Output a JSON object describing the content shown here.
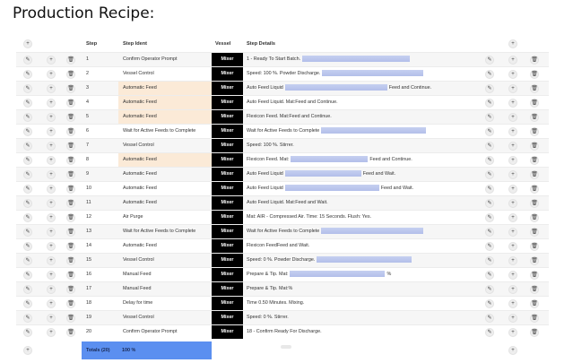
{
  "page_title": "Production Recipe:",
  "headers": {
    "step": "Step",
    "step_ident": "Step Ident",
    "vessel": "Vessel",
    "step_details": "Step Details"
  },
  "icons": {
    "edit": "pencil-icon",
    "add": "plus-circle-icon",
    "delete": "trash-icon"
  },
  "colors": {
    "vessel_bg": "#000000",
    "highlight": "#fbead7",
    "totals_bg": "#5b8ff0",
    "bar": "#c5cff0"
  },
  "rows": [
    {
      "step": "1",
      "ident": "Confirm Operator Prompt",
      "vessel": "Mixer",
      "details": "1 - Ready To Start Batch.",
      "suffix": "",
      "highlight": false
    },
    {
      "step": "2",
      "ident": "Vessel Control",
      "vessel": "Mixer",
      "details": "Speed: 100 %. Powder Discharge.",
      "suffix": "",
      "highlight": false
    },
    {
      "step": "3",
      "ident": "Automatic Feed",
      "vessel": "Mixer",
      "details": "Auto Feed Liquid",
      "suffix": "Feed and Continue.",
      "highlight": true
    },
    {
      "step": "4",
      "ident": "Automatic Feed",
      "vessel": "Mixer",
      "details": "Auto Feed Liquid. Mat:",
      "suffix": "Feed and Continue.",
      "highlight": true
    },
    {
      "step": "5",
      "ident": "Automatic Feed",
      "vessel": "Mixer",
      "details": "Flexicon Feed. Mat:",
      "suffix": "Feed and Continue.",
      "highlight": true
    },
    {
      "step": "6",
      "ident": "Wait for Active Feeds to Complete",
      "vessel": "Mixer",
      "details": "Wait for Active Feeds to Complete",
      "suffix": "",
      "highlight": false
    },
    {
      "step": "7",
      "ident": "Vessel Control",
      "vessel": "Mixer",
      "details": "Speed: 100 %. Stirrer.",
      "suffix": "",
      "highlight": false
    },
    {
      "step": "8",
      "ident": "Automatic Feed",
      "vessel": "Mixer",
      "details": "Flexicon Feed. Mat:",
      "suffix": "Feed and Continue.",
      "highlight": true
    },
    {
      "step": "9",
      "ident": "Automatic Feed",
      "vessel": "Mixer",
      "details": "Auto Feed Liquid",
      "suffix": "Feed and Wait.",
      "highlight": false
    },
    {
      "step": "10",
      "ident": "Automatic Feed",
      "vessel": "Mixer",
      "details": "Auto Feed Liquid",
      "suffix": "Feed and Wait.",
      "highlight": false
    },
    {
      "step": "11",
      "ident": "Automatic Feed",
      "vessel": "Mixer",
      "details": "Auto Feed Liquid. Mat:",
      "suffix": "Feed and Wait.",
      "highlight": false
    },
    {
      "step": "12",
      "ident": "Air Purge",
      "vessel": "Mixer",
      "details": "Mat: AIR - Compressed Air. Time: 15 Seconds. Flush: Yes.",
      "suffix": "",
      "highlight": false
    },
    {
      "step": "13",
      "ident": "Wait for Active Feeds to Complete",
      "vessel": "Mixer",
      "details": "Wait for Active Feeds to Complete",
      "suffix": "",
      "highlight": false
    },
    {
      "step": "14",
      "ident": "Automatic Feed",
      "vessel": "Mixer",
      "details": "Flexicon Feed",
      "suffix": "Feed and Wait.",
      "highlight": false
    },
    {
      "step": "15",
      "ident": "Vessel Control",
      "vessel": "Mixer",
      "details": "Speed: 0 %. Powder Discharge.",
      "suffix": "",
      "highlight": false
    },
    {
      "step": "16",
      "ident": "Manual Feed",
      "vessel": "Mixer",
      "details": "Prepare & Tip. Mat:",
      "suffix": "%",
      "highlight": false
    },
    {
      "step": "17",
      "ident": "Manual Feed",
      "vessel": "Mixer",
      "details": "Prepare & Tip. Mat:",
      "suffix": "%",
      "highlight": false
    },
    {
      "step": "18",
      "ident": "Delay for time",
      "vessel": "Mixer",
      "details": "Time 0.50 Minutes. Mixing.",
      "suffix": "",
      "highlight": false
    },
    {
      "step": "19",
      "ident": "Vessel Control",
      "vessel": "Mixer",
      "details": "Speed: 0 %. Stirrer.",
      "suffix": "",
      "highlight": false
    },
    {
      "step": "20",
      "ident": "Confirm Operator Prompt",
      "vessel": "Mixer",
      "details": "18 - Confirm Ready For Discharge.",
      "suffix": "",
      "highlight": false
    }
  ],
  "totals": {
    "label": "Totals (20)",
    "value": "100 %"
  }
}
